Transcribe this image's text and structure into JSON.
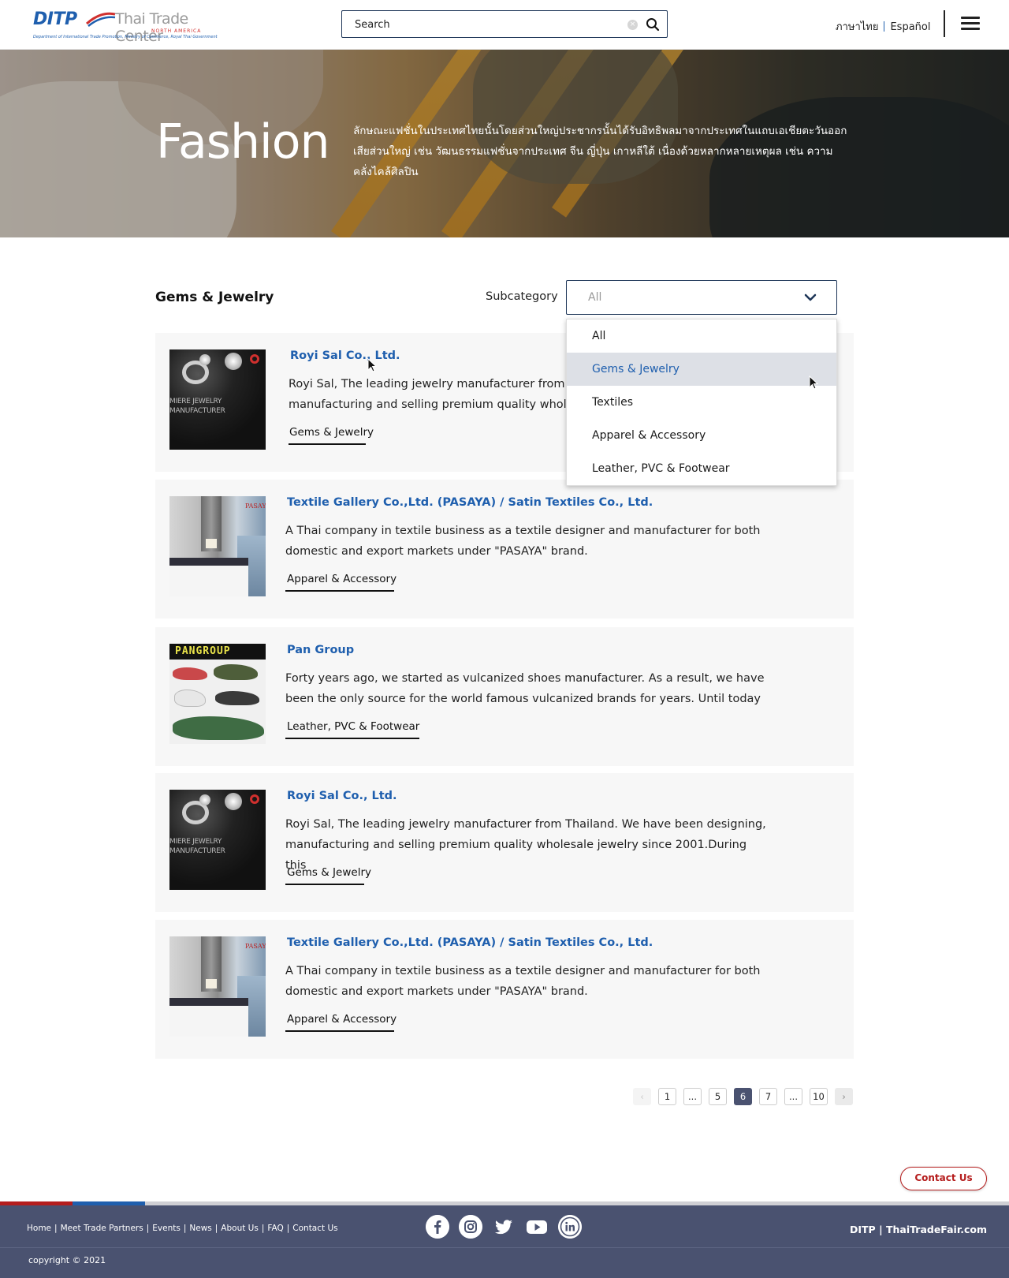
{
  "header": {
    "logo_ditp": "DITP",
    "logo_name": "Thai Trade Center",
    "logo_region": "NORTH AMERICA",
    "logo_subline": "Department of International Trade Promotion, Ministry of Commerce, Royal Thai Government",
    "search_placeholder": "Search",
    "lang_thai": "ภาษาไทย",
    "lang_spanish": "Español"
  },
  "hero": {
    "title": "Fashion",
    "description": "ลักษณะแฟชั่นในประเทศไทยนั้นโดยส่วนใหญ่ประชากรนั้นได้รับอิทธิพลมาจากประเทศในแถบเอเชียตะวันออก เสียส่วนใหญ่ เช่น วัฒนธรรมแฟชั่นจากประเทศ จีน ญี่ปุ่น เกาหลีใต้ เนื่องด้วยหลากหลายเหตุผล เช่น ความคลั่งไคล้ศิลปิน"
  },
  "section": {
    "title": "Gems & Jewelry",
    "subcategory_label": "Subcategory",
    "select_value": "All",
    "options": [
      "All",
      "Gems & Jewelry",
      "Textiles",
      "Apparel & Accessory",
      "Leather, PVC & Footwear"
    ]
  },
  "cards": [
    {
      "name": "Royi Sal Co., Ltd.",
      "desc_line1": "Royi Sal, The leading jewelry manufacturer from T",
      "desc_line2": "manufacturing and selling premium quality wholes",
      "tag": "Gems & Jewelry",
      "thumb_text": "MIERE JEWELRY\nMANUFACTURER"
    },
    {
      "name": "Textile Gallery Co.,Ltd. (PASAYA) / Satin Textiles Co., Ltd.",
      "desc_line1": "A Thai company in textile business as a textile designer and manufacturer for both",
      "desc_line2": "domestic and export markets under \"PASAYA\" brand.",
      "tag": "Apparel & Accessory",
      "thumb_text": "PASAYA"
    },
    {
      "name": "Pan Group",
      "desc_line1": "Forty years ago, we started as vulcanized shoes manufacturer. As a result, we have",
      "desc_line2": "been the only source for the world famous vulcanized brands for years. Until today",
      "tag": "Leather, PVC & Footwear",
      "thumb_text": "PANGROUP"
    },
    {
      "name": "Royi Sal Co., Ltd.",
      "desc_line1": "Royi Sal, The leading jewelry manufacturer from Thailand. We have been designing,",
      "desc_line2": "manufacturing and selling premium quality wholesale jewelry since 2001.During this",
      "tag": "Gems & Jewelry",
      "thumb_text": "MIERE JEWELRY\nMANUFACTURER"
    },
    {
      "name": "Textile Gallery Co.,Ltd. (PASAYA) / Satin Textiles Co., Ltd.",
      "desc_line1": "A Thai company in textile business as a textile designer and manufacturer for both",
      "desc_line2": "domestic and export markets under \"PASAYA\" brand.",
      "tag": "Apparel & Accessory",
      "thumb_text": "PASAYA"
    }
  ],
  "pagination": {
    "prev": "‹",
    "pages": [
      "1",
      "...",
      "5",
      "6",
      "7",
      "...",
      "10"
    ],
    "current": "6",
    "next": "›"
  },
  "contact_button": "Contact Us",
  "footer": {
    "links": [
      "Home",
      "Meet Trade Partners",
      "Events",
      "News",
      "About Us",
      "FAQ",
      "Contact Us"
    ],
    "social_icons": [
      "facebook-icon",
      "instagram-icon",
      "twitter-icon",
      "youtube-icon",
      "linkedin-icon"
    ],
    "brand": "DITP | ThaiTradeFair.com",
    "copyright": "copyright © 2021"
  },
  "colors": {
    "accent_blue": "#1f5fae",
    "navy": "#1d3557",
    "footer_bg": "#4a5270",
    "contact_red": "#b51d1d",
    "footer_bar_red": "#b51d1d",
    "footer_bar_blue": "#1f5fae",
    "footer_bar_grey": "#cfcfd4"
  }
}
